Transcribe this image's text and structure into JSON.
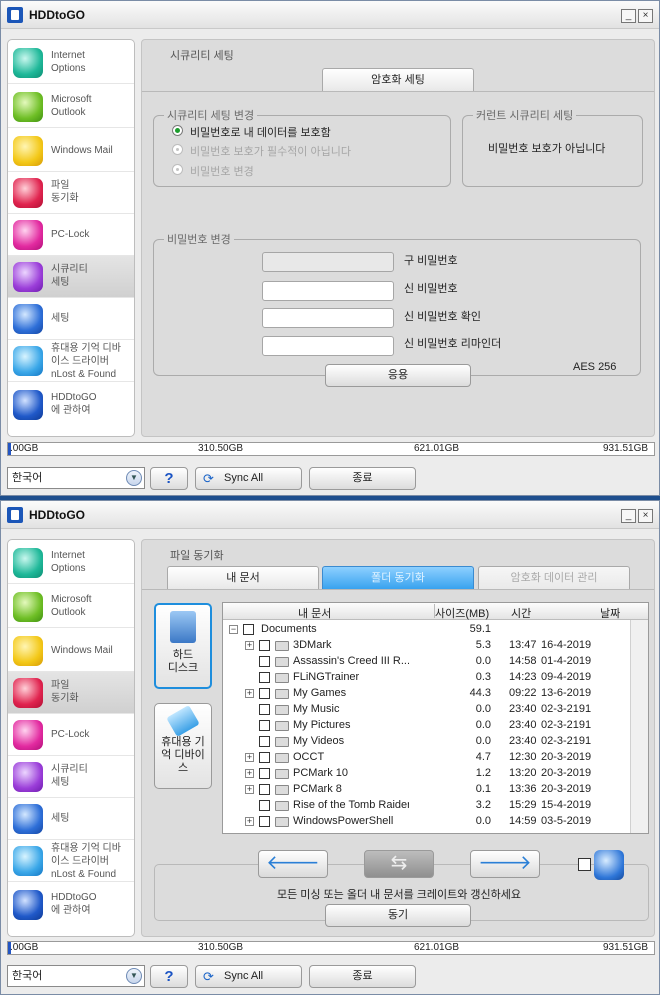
{
  "app": {
    "title": "HDDtoGO"
  },
  "window_controls": {
    "minimize": "_",
    "close": "×"
  },
  "sidebar": {
    "items": [
      {
        "label": "Internet\nOptions",
        "icon": "internet-options-icon"
      },
      {
        "label": "Microsoft\nOutlook",
        "icon": "outlook-icon"
      },
      {
        "label": "Windows Mail",
        "icon": "windows-mail-icon"
      },
      {
        "label": "파일\n동기화",
        "icon": "file-sync-icon"
      },
      {
        "label": "PC-Lock",
        "icon": "key-icon"
      },
      {
        "label": "시큐리티\n세팅",
        "icon": "security-icon"
      },
      {
        "label": "세팅",
        "icon": "settings-gear-icon"
      },
      {
        "label": "휴대용 기억 디바\n이스 드라이버\nnLost & Found",
        "icon": "usb-drive-icon"
      },
      {
        "label": "HDDtoGO\n에 관하여",
        "icon": "about-icon"
      }
    ]
  },
  "security": {
    "page_title": "시큐리티 세팅",
    "tab": "암호화 세팅",
    "change_group": {
      "legend": "시큐리티 세팅 변경",
      "options": [
        "비밀번호로 내 데이터를 보호함",
        "비밀번호 보호가 필수적이 아닙니다",
        "비밀번호 변경"
      ]
    },
    "current_group": {
      "legend": "커런트 시큐리티 세팅",
      "value": "비밀번호 보호가 아닙니다"
    },
    "password_group": {
      "legend": "비밀번호 변경",
      "fields": [
        "구 비밀번호",
        "신 비밀번호",
        "신 비밀번호 확인",
        "신 비밀번호 리마인더"
      ],
      "encryption": "AES 256",
      "apply_button": "응용"
    }
  },
  "filesync": {
    "page_title": "파일 동기화",
    "tabs": [
      "내 문서",
      "폴더 동기화",
      "암호화 데이터 관리"
    ],
    "drives": [
      "하드\n디스크",
      "휴대용 기\n억 디바이\n스"
    ],
    "columns": {
      "name": "내 문서",
      "size": "사이즈(MB)",
      "time": "시간",
      "date": "날짜"
    },
    "root": {
      "name": "Documents",
      "size": "59.1"
    },
    "rows": [
      {
        "name": "3DMark",
        "size": "5.3",
        "time": "13:47",
        "date": "16-4-2019",
        "expandable": true
      },
      {
        "name": "Assassin's Creed III R...",
        "size": "0.0",
        "time": "14:58",
        "date": "01-4-2019",
        "expandable": false
      },
      {
        "name": "FLiNGTrainer",
        "size": "0.3",
        "time": "14:23",
        "date": "09-4-2019",
        "expandable": false
      },
      {
        "name": "My Games",
        "size": "44.3",
        "time": "09:22",
        "date": "13-6-2019",
        "expandable": true
      },
      {
        "name": "My Music",
        "size": "0.0",
        "time": "23:40",
        "date": "02-3-2191",
        "expandable": false
      },
      {
        "name": "My Pictures",
        "size": "0.0",
        "time": "23:40",
        "date": "02-3-2191",
        "expandable": false
      },
      {
        "name": "My Videos",
        "size": "0.0",
        "time": "23:40",
        "date": "02-3-2191",
        "expandable": false
      },
      {
        "name": "OCCT",
        "size": "4.7",
        "time": "12:30",
        "date": "20-3-2019",
        "expandable": true
      },
      {
        "name": "PCMark 10",
        "size": "1.2",
        "time": "13:20",
        "date": "20-3-2019",
        "expandable": true
      },
      {
        "name": "PCMark 8",
        "size": "0.1",
        "time": "13:36",
        "date": "20-3-2019",
        "expandable": true
      },
      {
        "name": "Rise of the Tomb Raider",
        "size": "3.2",
        "time": "15:29",
        "date": "15-4-2019",
        "expandable": false
      },
      {
        "name": "WindowsPowerShell",
        "size": "0.0",
        "time": "14:59",
        "date": "03-5-2019",
        "expandable": true
      }
    ],
    "hint": "모든 미싱 또는 올더 내 문서를 크레이트와 갱신하세요",
    "sync_button": "동기"
  },
  "storage": {
    "ticks": [
      ".00GB",
      "310.50GB",
      "621.01GB",
      "931.51GB"
    ],
    "used_fraction": 0.005
  },
  "footer": {
    "language": "한국어",
    "help": "?",
    "sync_all": "Sync All",
    "exit": "종료"
  }
}
